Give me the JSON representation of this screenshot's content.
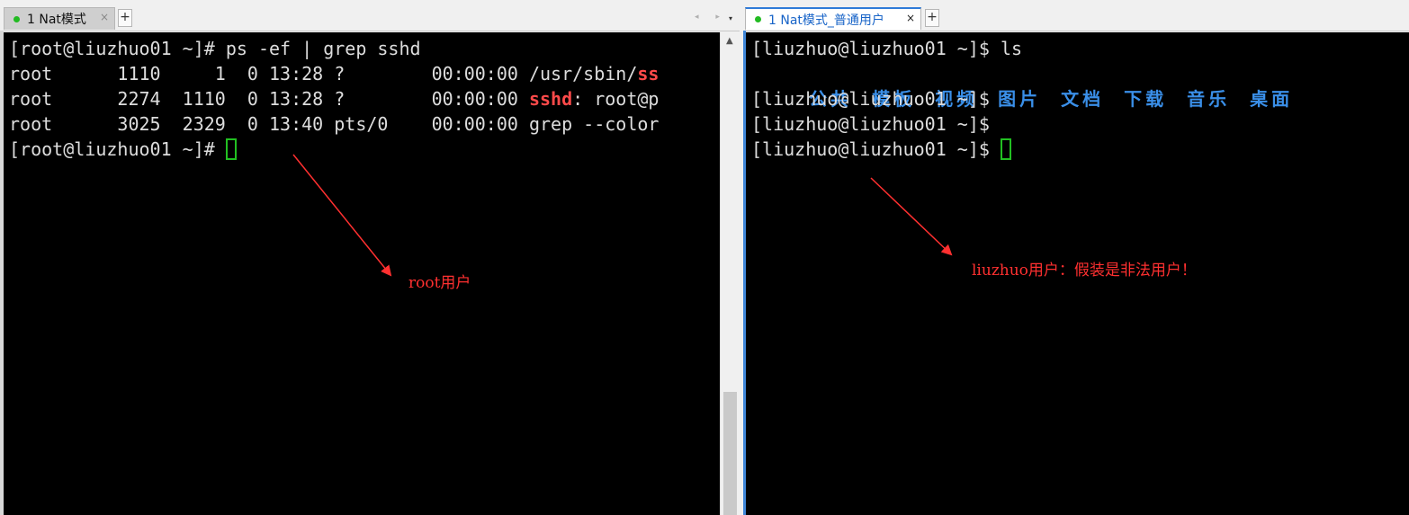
{
  "left_tab": {
    "label": "1 Nat模式",
    "close": "×",
    "new": "+"
  },
  "left_nav": {
    "arrows": "◂ ▸",
    "dropdown": "▾"
  },
  "right_tab": {
    "label": "1 Nat模式_普通用户",
    "close": "×",
    "new": "+"
  },
  "left_terminal": {
    "line1": "[root@liuzhuo01 ~]# ps -ef | grep sshd",
    "line2_pre": "root      1110     1  0 13:28 ?        00:00:00 /usr/sbin/",
    "line2_hl": "ss",
    "line3_pre": "root      2274  1110  0 13:28 ?        00:00:00 ",
    "line3_hl": "sshd",
    "line3_post": ": root@p",
    "line4": "root      3025  2329  0 13:40 pts/0    00:00:00 grep --color",
    "prompt": "[root@liuzhuo01 ~]# "
  },
  "right_terminal": {
    "line1": "[liuzhuo@liuzhuo01 ~]$ ls",
    "dirs": [
      "公共",
      "模板",
      "视频",
      "图片",
      "文档",
      "下载",
      "音乐",
      "桌面"
    ],
    "line3": "[liuzhuo@liuzhuo01 ~]$",
    "line4": "[liuzhuo@liuzhuo01 ~]$",
    "prompt": "[liuzhuo@liuzhuo01 ~]$ "
  },
  "annotations": {
    "left": "root用户",
    "right": "liuzhuo用户：假装是非法用户！"
  },
  "colors": {
    "accent": "#2f7bd8",
    "annotation": "#ff3030",
    "dir": "#3a8fe8",
    "cursor": "#22c022"
  }
}
